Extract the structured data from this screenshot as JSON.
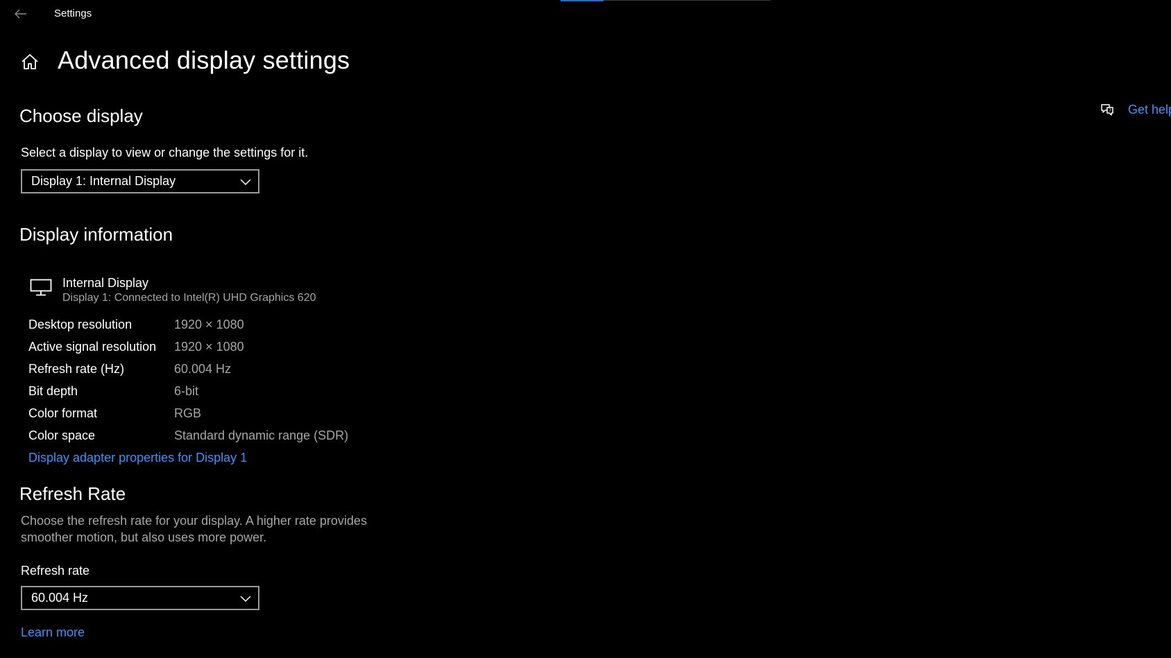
{
  "window": {
    "title": "Settings"
  },
  "header": {
    "page_title": "Advanced display settings",
    "icons": [
      "back-arrow-icon",
      "home-icon"
    ]
  },
  "help": {
    "label": "Get help",
    "icon": "help-chat-icon"
  },
  "choose_display": {
    "heading": "Choose display",
    "description": "Select a display to view or change the settings for it.",
    "selected": "Display 1: Internal Display"
  },
  "display_info": {
    "heading": "Display information",
    "display_icon": "monitor-icon",
    "display_name": "Internal Display",
    "display_sub": "Display 1: Connected to Intel(R) UHD Graphics 620",
    "rows": [
      {
        "label": "Desktop resolution",
        "value": "1920 × 1080"
      },
      {
        "label": "Active signal resolution",
        "value": "1920 × 1080"
      },
      {
        "label": "Refresh rate (Hz)",
        "value": "60.004 Hz"
      },
      {
        "label": "Bit depth",
        "value": "6-bit"
      },
      {
        "label": "Color format",
        "value": "RGB"
      },
      {
        "label": "Color space",
        "value": "Standard dynamic range (SDR)"
      }
    ],
    "adapter_link": "Display adapter properties for Display 1"
  },
  "refresh_rate": {
    "heading": "Refresh Rate",
    "description": "Choose the refresh rate for your display. A higher rate provides smoother motion, but also uses more power.",
    "field_label": "Refresh rate",
    "selected": "60.004 Hz",
    "learn_more": "Learn more"
  },
  "colors": {
    "background": "#000000",
    "text": "#ffffff",
    "muted": "#a6a6a6",
    "link": "#3794ff",
    "accent": "#1f6fd1"
  }
}
